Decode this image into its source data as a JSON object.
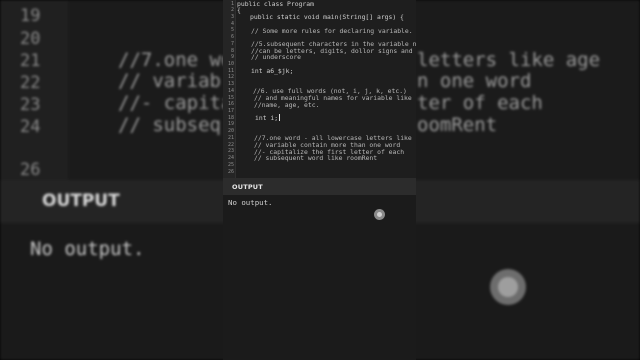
{
  "code_lines": [
    {
      "n": "1",
      "text": "public class Program"
    },
    {
      "n": "2",
      "text": "{"
    },
    {
      "n": "3",
      "text": "public static void main(String[] args) {"
    },
    {
      "n": "4",
      "text": ""
    },
    {
      "n": "5",
      "text": "// Some more rules for declaring variable."
    },
    {
      "n": "6",
      "text": ""
    },
    {
      "n": "7",
      "text": "//5.subsequent characters in the variable name"
    },
    {
      "n": "8",
      "text": "//can be letters, digits, dollor signs and"
    },
    {
      "n": "9",
      "text": "// underscore"
    },
    {
      "n": "10",
      "text": ""
    },
    {
      "n": "11",
      "text": "int a6_$jk;"
    },
    {
      "n": "12",
      "text": ""
    },
    {
      "n": "13",
      "text": ""
    },
    {
      "n": "14",
      "text": "//6. use full words (not, i, j, k, etc.)"
    },
    {
      "n": "15",
      "text": "// and meaningful names for variable like"
    },
    {
      "n": "16",
      "text": "//name, age, etc."
    },
    {
      "n": "17",
      "text": ""
    },
    {
      "n": "18",
      "text": "int i;"
    },
    {
      "n": "19",
      "text": ""
    },
    {
      "n": "20",
      "text": ""
    },
    {
      "n": "21",
      "text": "//7.one word - all lowercase letters like age"
    },
    {
      "n": "22",
      "text": "// variable contain more than one word"
    },
    {
      "n": "23",
      "text": "//- capitalize the first letter of each"
    },
    {
      "n": "24",
      "text": "// subsequent word like roomRent"
    },
    {
      "n": "25",
      "text": ""
    },
    {
      "n": "26",
      "text": ""
    }
  ],
  "output": {
    "title": "OUTPUT",
    "text": "No output."
  },
  "background": {
    "line_numbers": [
      "19",
      "20",
      "21",
      "22",
      "23",
      "24",
      "26"
    ],
    "left_fragments": [
      "//7.one wo",
      "// variab",
      "//- capital",
      "// subseq"
    ],
    "right_fragments": [
      "letters like age",
      "n one word",
      "ter of each",
      "oomRent"
    ],
    "output_title": "OUTPUT",
    "output_text": "No output."
  }
}
